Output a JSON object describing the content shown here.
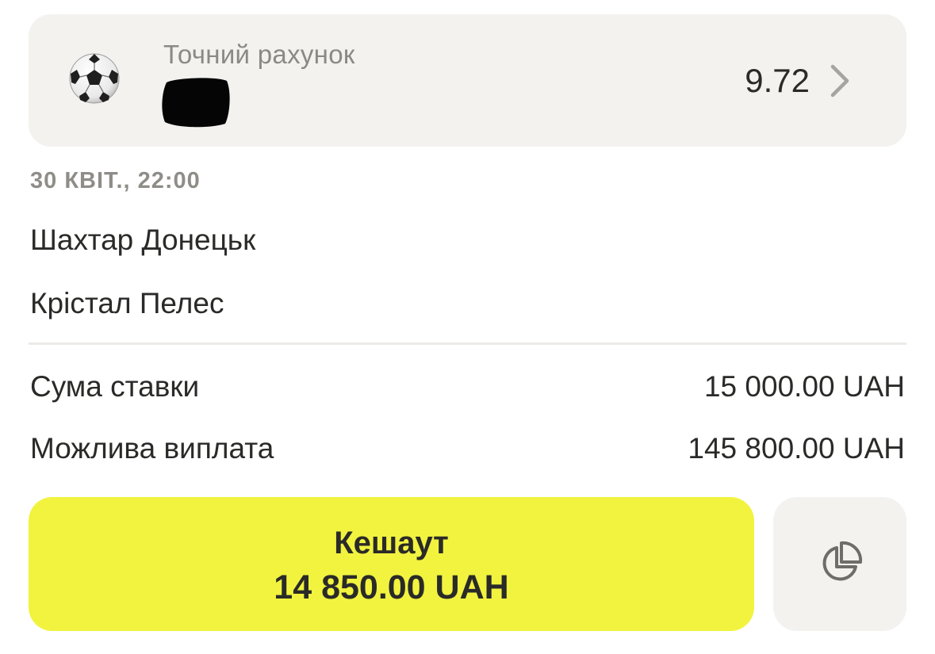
{
  "market": {
    "label": "Точний рахунок",
    "odds": "9.72",
    "sport_icon": "soccer-ball-icon",
    "nav_icon": "chevron-right-icon"
  },
  "event": {
    "date": "30 КВІТ., 22:00",
    "home_team": "Шахтар Донецьк",
    "away_team": "Крістал Пелес"
  },
  "summary": {
    "stake_label": "Сума ставки",
    "stake_value": "15 000.00 UAH",
    "payout_label": "Можлива виплата",
    "payout_value": "145 800.00 UAH"
  },
  "cashout": {
    "title": "Кешаут",
    "amount": "14 850.00 UAH",
    "partial_icon": "pie-chart-icon"
  },
  "colors": {
    "card_bg": "#f3f2ef",
    "cashout_bg": "#f1f33f",
    "text": "#2a2a28",
    "muted_text": "#8b8985"
  }
}
